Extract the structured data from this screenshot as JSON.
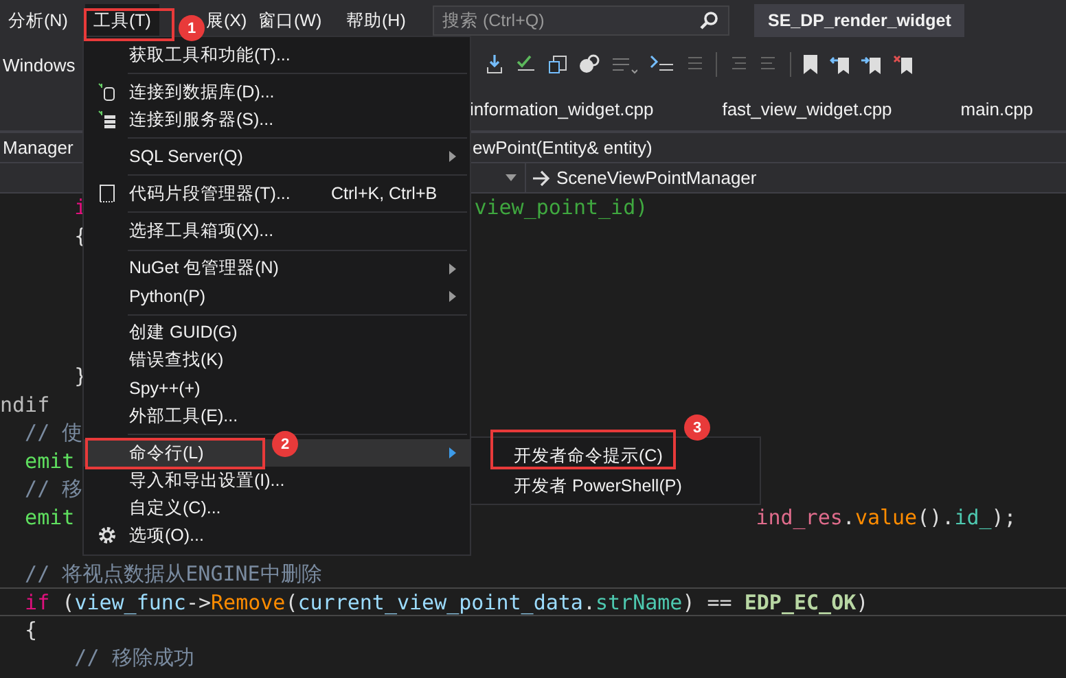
{
  "menu_bar": {
    "items": [
      {
        "label": "分析(N)",
        "selected": false
      },
      {
        "label": "工具(T)",
        "selected": true
      },
      {
        "label": "展(X)",
        "selected": false
      },
      {
        "label": "窗口(W)",
        "selected": false
      },
      {
        "label": "帮助(H)",
        "selected": false
      }
    ],
    "search": {
      "placeholder": "搜索 (Ctrl+Q)"
    },
    "solution_title": "SE_DP_render_widget"
  },
  "toolbar": {
    "config_label": "Windows"
  },
  "tabs": [
    {
      "label": "information_widget.cpp",
      "selected": false
    },
    {
      "label": "fast_view_widget.cpp",
      "selected": false
    },
    {
      "label": "main.cpp",
      "selected": false
    }
  ],
  "nav_bar": {
    "scope": "Manager",
    "member": "ewPoint(Entity& entity)",
    "class_path": "SceneViewPointManager"
  },
  "code_lines": [
    {
      "left": [
        {
          "text": "      i",
          "kind": "kw"
        }
      ],
      "right": {
        "kind": "after-menu",
        "tokens": [
          {
            "text": "view_point_id)",
            "kind": "str"
          }
        ]
      },
      "current": false
    },
    {
      "left": [
        {
          "text": "      {",
          "kind": "plain"
        }
      ],
      "current": false
    },
    {
      "current": false
    },
    {
      "current": false
    },
    {
      "current": false
    },
    {
      "current": false
    },
    {
      "left": [
        {
          "text": "      }",
          "kind": "plain"
        }
      ],
      "current": false
    },
    {
      "left": [
        {
          "text": "ndif",
          "kind": "macro"
        }
      ],
      "current": false
    },
    {
      "left": [
        {
          "text": "  // 使",
          "kind": "comment"
        }
      ],
      "current": false
    },
    {
      "left": [
        {
          "text": "  emit",
          "kind": "emit"
        }
      ],
      "current": false
    },
    {
      "left": [
        {
          "text": "  // 移",
          "kind": "comment"
        }
      ],
      "current": false
    },
    {
      "left": [
        {
          "text": "  emit",
          "kind": "emit"
        }
      ],
      "right": {
        "kind": "after-submenu",
        "tokens": [
          {
            "text": "ind_res",
            "kind": "var2"
          },
          {
            "text": ".",
            "kind": "plain"
          },
          {
            "text": "value",
            "kind": "func"
          },
          {
            "text": "().",
            "kind": "plain"
          },
          {
            "text": "id_",
            "kind": "member"
          },
          {
            "text": ");",
            "kind": "plain"
          }
        ]
      },
      "current": false
    },
    {
      "current": false
    },
    {
      "left": [
        {
          "text": "  // 将视点数据从ENGINE中删除",
          "kind": "comment"
        }
      ],
      "current": false
    },
    {
      "left": [
        {
          "text": "  if",
          "kind": "kw"
        },
        {
          "text": " (",
          "kind": "plain"
        },
        {
          "text": "view_func",
          "kind": "var"
        },
        {
          "text": "->",
          "kind": "plain"
        },
        {
          "text": "Remove",
          "kind": "func"
        },
        {
          "text": "(",
          "kind": "plain"
        },
        {
          "text": "current_view_point_data",
          "kind": "var"
        },
        {
          "text": ".",
          "kind": "plain"
        },
        {
          "text": "strName",
          "kind": "member"
        },
        {
          "text": ") == ",
          "kind": "plain"
        },
        {
          "text": "EDP_EC_OK",
          "kind": "const"
        },
        {
          "text": ")",
          "kind": "plain"
        }
      ],
      "current": true
    },
    {
      "left": [
        {
          "text": "  {",
          "kind": "plain"
        }
      ],
      "current": false
    },
    {
      "left": [
        {
          "text": "      // 移除成功",
          "kind": "comment"
        }
      ],
      "current": false
    }
  ],
  "tools_menu": [
    {
      "kind": "item",
      "label": "获取工具和功能(T)...",
      "submenu": false,
      "selected": false
    },
    {
      "kind": "separator"
    },
    {
      "kind": "item",
      "label": "连接到数据库(D)...",
      "submenu": false,
      "selected": false
    },
    {
      "kind": "item",
      "label": "连接到服务器(S)...",
      "submenu": false,
      "selected": false
    },
    {
      "kind": "separator"
    },
    {
      "kind": "item",
      "label": "SQL Server(Q)",
      "submenu": true,
      "selected": false
    },
    {
      "kind": "separator"
    },
    {
      "kind": "item",
      "label": "代码片段管理器(T)...",
      "shortcut": "Ctrl+K, Ctrl+B",
      "submenu": false,
      "selected": false
    },
    {
      "kind": "separator"
    },
    {
      "kind": "item",
      "label": "选择工具箱项(X)...",
      "submenu": false,
      "selected": false
    },
    {
      "kind": "separator"
    },
    {
      "kind": "item",
      "label": "NuGet 包管理器(N)",
      "submenu": true,
      "selected": false
    },
    {
      "kind": "item",
      "label": "Python(P)",
      "submenu": true,
      "selected": false
    },
    {
      "kind": "separator"
    },
    {
      "kind": "item",
      "label": "创建 GUID(G)",
      "submenu": false,
      "selected": false
    },
    {
      "kind": "item",
      "label": "错误查找(K)",
      "submenu": false,
      "selected": false
    },
    {
      "kind": "item",
      "label": "Spy++(+)",
      "submenu": false,
      "selected": false
    },
    {
      "kind": "item",
      "label": "外部工具(E)...",
      "submenu": false,
      "selected": false
    },
    {
      "kind": "separator"
    },
    {
      "kind": "item",
      "label": "命令行(L)",
      "submenu": true,
      "selected": true
    },
    {
      "kind": "item",
      "label": "导入和导出设置(I)...",
      "submenu": false,
      "selected": false
    },
    {
      "kind": "item",
      "label": "自定义(C)...",
      "submenu": false,
      "selected": false
    },
    {
      "kind": "item",
      "label": "选项(O)...",
      "submenu": false,
      "selected": false
    }
  ],
  "command_line_submenu": [
    {
      "label": "开发者命令提示(C)",
      "selected": false
    },
    {
      "label": "开发者 PowerShell(P)",
      "selected": false
    }
  ],
  "annotations": [
    {
      "label": "1"
    },
    {
      "label": "2"
    },
    {
      "label": "3"
    }
  ]
}
